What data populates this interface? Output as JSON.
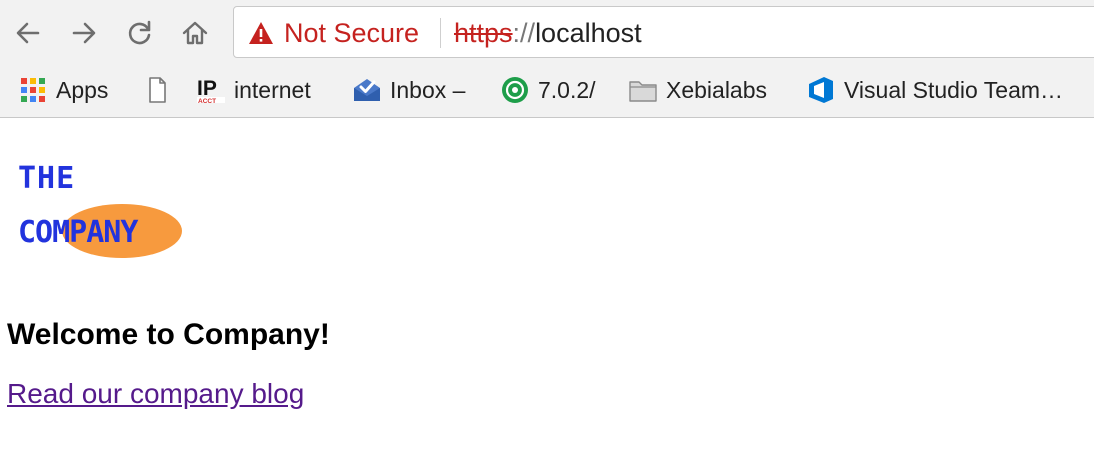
{
  "browser": {
    "security_label": "Not Secure",
    "url": {
      "scheme": "https",
      "separator": "://",
      "host": "localhost"
    },
    "bookmarks": [
      {
        "label": "Apps",
        "icon": "apps-grid-icon"
      },
      {
        "label": "",
        "icon": "page-icon"
      },
      {
        "label": "internet",
        "icon": "ip-acct-icon"
      },
      {
        "label": "Inbox –",
        "icon": "inbox-icon"
      },
      {
        "label": "7.0.2/",
        "icon": "green-circle-icon"
      },
      {
        "label": "Xebialabs",
        "icon": "folder-icon"
      },
      {
        "label": "Visual Studio Team…",
        "icon": "visual-studio-icon"
      }
    ],
    "colors": {
      "insecure": "#c5221f",
      "toolbar": "#f2f2f2"
    }
  },
  "page": {
    "logo": {
      "line1": "THE",
      "line2": "COMPANY"
    },
    "heading": "Welcome to Company!",
    "blog_link": "Read our company blog",
    "colors": {
      "link_visited": "#551a8b",
      "logo_blue": "#2233dd",
      "logo_orange": "#f79a3e"
    }
  }
}
